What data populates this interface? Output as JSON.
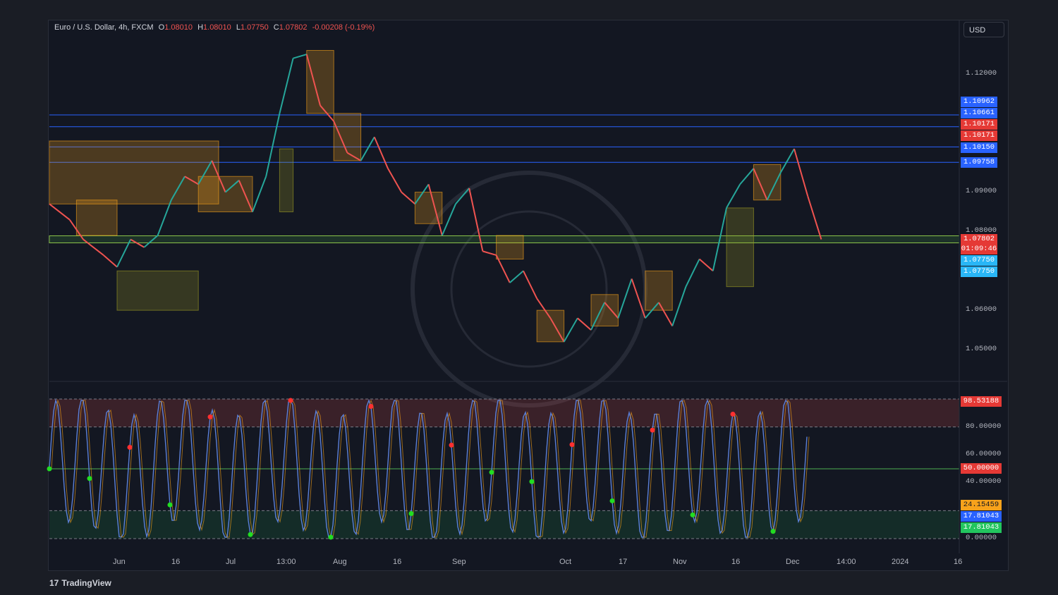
{
  "header": {
    "symbol": "Euro / U.S. Dollar, 4h, FXCM",
    "o_label": "O",
    "o": "1.08010",
    "h_label": "H",
    "h": "1.08010",
    "l_label": "L",
    "l": "1.07750",
    "c_label": "C",
    "c": "1.07802",
    "change": "-0.00208 (-0.19%)"
  },
  "currency": "USD",
  "brand": "TradingView",
  "colors": {
    "up": "#26a69a",
    "down": "#ef5350",
    "blue": "#2962ff",
    "green": "#4caf50",
    "orange": "#f7a21b"
  },
  "price_axis": {
    "ticks": [
      "1.12000",
      "1.09000",
      "1.08000",
      "1.06000",
      "1.05000"
    ]
  },
  "price_tags": [
    {
      "value": "1.10962",
      "color": "#2962ff"
    },
    {
      "value": "1.10661",
      "color": "#2962ff"
    },
    {
      "value": "1.10171",
      "color": "#e53935"
    },
    {
      "value": "1.10171",
      "color": "#e53935"
    },
    {
      "value": "1.10150",
      "color": "#2962ff"
    },
    {
      "value": "1.09758",
      "color": "#2962ff"
    },
    {
      "value": "1.07802",
      "color": "#e53935"
    },
    {
      "value": "01:09:46",
      "color": "#e53935"
    },
    {
      "value": "1.07750",
      "color": "#29b6f6"
    },
    {
      "value": "1.07750",
      "color": "#29b6f6"
    }
  ],
  "osc_axis": {
    "ticks": [
      "80.00000",
      "60.00000",
      "40.00000",
      "0.00000"
    ]
  },
  "osc_tags": [
    {
      "value": "98.53188",
      "color": "#e53935"
    },
    {
      "value": "50.00000",
      "color": "#e53935"
    },
    {
      "value": "24.15459",
      "color": "#f7a21b"
    },
    {
      "value": "17.81043",
      "color": "#2962ff"
    },
    {
      "value": "17.81043",
      "color": "#22c55e"
    }
  ],
  "time_axis": [
    "Jun",
    "16",
    "Jul",
    "13:00",
    "Aug",
    "16",
    "Sep",
    "Oct",
    "17",
    "Nov",
    "16",
    "Dec",
    "14:00",
    "2024",
    "16"
  ],
  "chart_data": {
    "type": "line",
    "title": "Euro / U.S. Dollar, 4h, FXCM",
    "panels": [
      {
        "name": "price",
        "y_range": [
          1.045,
          1.128
        ],
        "close_path": [
          [
            0,
            1.087
          ],
          [
            3,
            1.083
          ],
          [
            5,
            1.078
          ],
          [
            8,
            1.074
          ],
          [
            10,
            1.071
          ],
          [
            12,
            1.078
          ],
          [
            14,
            1.076
          ],
          [
            16,
            1.079
          ],
          [
            18,
            1.088
          ],
          [
            20,
            1.094
          ],
          [
            22,
            1.092
          ],
          [
            24,
            1.098
          ],
          [
            26,
            1.09
          ],
          [
            28,
            1.093
          ],
          [
            30,
            1.085
          ],
          [
            32,
            1.094
          ],
          [
            34,
            1.11
          ],
          [
            36,
            1.124
          ],
          [
            38,
            1.125
          ],
          [
            40,
            1.112
          ],
          [
            42,
            1.108
          ],
          [
            44,
            1.1
          ],
          [
            46,
            1.098
          ],
          [
            48,
            1.104
          ],
          [
            50,
            1.096
          ],
          [
            52,
            1.09
          ],
          [
            54,
            1.087
          ],
          [
            56,
            1.092
          ],
          [
            58,
            1.079
          ],
          [
            60,
            1.087
          ],
          [
            62,
            1.091
          ],
          [
            64,
            1.075
          ],
          [
            66,
            1.074
          ],
          [
            68,
            1.067
          ],
          [
            70,
            1.07
          ],
          [
            72,
            1.063
          ],
          [
            74,
            1.058
          ],
          [
            76,
            1.052
          ],
          [
            78,
            1.058
          ],
          [
            80,
            1.055
          ],
          [
            82,
            1.062
          ],
          [
            84,
            1.058
          ],
          [
            86,
            1.068
          ],
          [
            88,
            1.058
          ],
          [
            90,
            1.062
          ],
          [
            92,
            1.056
          ],
          [
            94,
            1.066
          ],
          [
            96,
            1.073
          ],
          [
            98,
            1.07
          ],
          [
            100,
            1.086
          ],
          [
            102,
            1.092
          ],
          [
            104,
            1.096
          ],
          [
            106,
            1.088
          ],
          [
            108,
            1.095
          ],
          [
            110,
            1.101
          ],
          [
            112,
            1.089
          ],
          [
            114,
            1.078
          ]
        ],
        "levels": [
          1.10962,
          1.10661,
          1.10171,
          1.1015,
          1.09758,
          1.07802,
          1.0775
        ]
      },
      {
        "name": "oscillator",
        "y_range": [
          0,
          100
        ],
        "bands": [
          20,
          50,
          80
        ],
        "last": [
          24.15459,
          17.81043,
          17.81043
        ],
        "overbought_max": 98.53188
      }
    ]
  }
}
